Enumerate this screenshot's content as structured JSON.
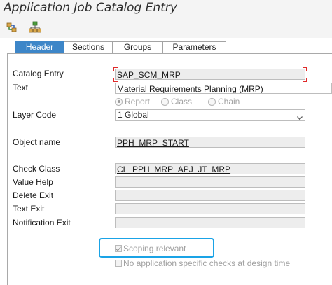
{
  "window": {
    "title": "Application Job Catalog Entry"
  },
  "toolbar": {
    "buttons": [
      {
        "name": "display-change-icon"
      },
      {
        "name": "hierarchy-icon"
      }
    ]
  },
  "tabs": [
    {
      "label": "Header",
      "active": true
    },
    {
      "label": "Sections",
      "active": false
    },
    {
      "label": "Groups",
      "active": false
    },
    {
      "label": "Parameters",
      "active": false
    }
  ],
  "form": {
    "catalog_entry": {
      "label": "Catalog Entry",
      "value": "SAP_SCM_MRP"
    },
    "text": {
      "label": "Text",
      "value": "Material Requirements Planning (MRP)"
    },
    "object_type": {
      "options": [
        {
          "label": "Report",
          "selected": true
        },
        {
          "label": "Class",
          "selected": false
        },
        {
          "label": "Chain",
          "selected": false
        }
      ]
    },
    "layer_code": {
      "label": "Layer Code",
      "value": "1 Global"
    },
    "object_name": {
      "label": "Object name",
      "value": "PPH_MRP_START"
    },
    "check_class": {
      "label": "Check Class",
      "value": "CL_PPH_MRP_APJ_JT_MRP"
    },
    "value_help": {
      "label": "Value Help",
      "value": ""
    },
    "delete_exit": {
      "label": "Delete Exit",
      "value": ""
    },
    "text_exit": {
      "label": "Text Exit",
      "value": ""
    },
    "notification_exit": {
      "label": "Notification Exit",
      "value": ""
    },
    "scoping_relevant": {
      "label": "Scoping relevant",
      "checked": true
    },
    "no_app_checks": {
      "label": "No application specific checks at design time",
      "checked": false
    }
  },
  "colors": {
    "active_tab": "#3d86c8",
    "highlight_border": "#1aa3e6",
    "required_marker": "#e02a2a"
  }
}
